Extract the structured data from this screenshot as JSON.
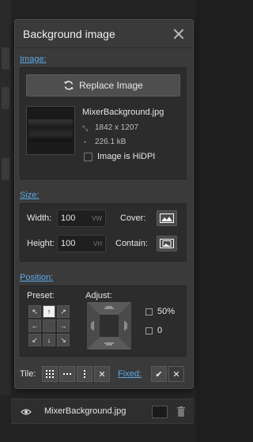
{
  "panel": {
    "title": "Background image"
  },
  "image_section": {
    "label": "Image:",
    "replace_button": "Replace Image",
    "file_name": "MixerBackground.jpg",
    "dimensions": "1842 x 1207",
    "file_size": "226.1 kB",
    "hidpi_label": "Image is HiDPI",
    "hidpi_checked": false
  },
  "size_section": {
    "label": "Size:",
    "width_label": "Width:",
    "width_value": "100",
    "width_unit": "VW",
    "height_label": "Height:",
    "height_value": "100",
    "height_unit": "VH",
    "cover_label": "Cover:",
    "contain_label": "Contain:"
  },
  "position_section": {
    "label": "Position:",
    "preset_label": "Preset:",
    "adjust_label": "Adjust:",
    "x_value": "50%",
    "y_value": "0",
    "preset_active": "top-center",
    "preset_arrows": [
      "↖",
      "↑",
      "↗",
      "←",
      "",
      "→",
      "↙",
      "↓",
      "↘"
    ]
  },
  "tile_section": {
    "label": "Tile:",
    "fixed_label": "Fixed:",
    "buttons": [
      "tile-both",
      "tile-x",
      "tile-y",
      "no-tile"
    ]
  },
  "layer_row": {
    "name": "MixerBackground.jpg"
  },
  "colors": {
    "accent": "#5aa8e8",
    "panel_bg": "#3a3a3a",
    "box_bg": "#2c2c2c"
  }
}
